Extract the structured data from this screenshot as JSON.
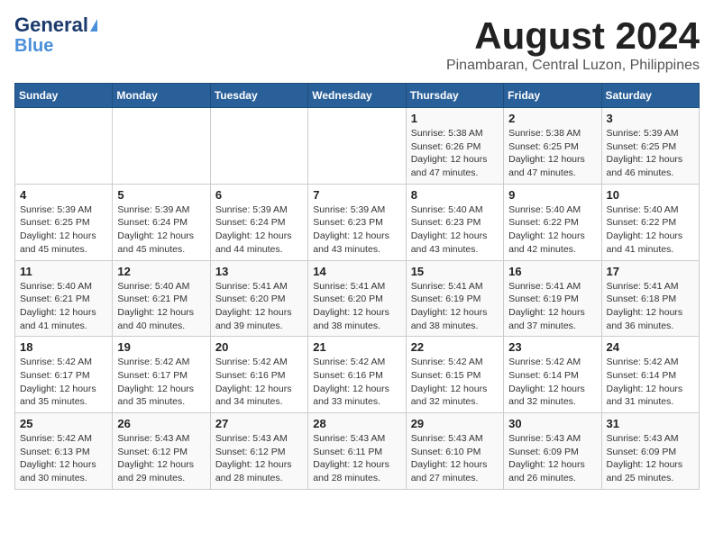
{
  "header": {
    "logo_line1": "General",
    "logo_line2": "Blue",
    "title": "August 2024",
    "subtitle": "Pinambaran, Central Luzon, Philippines"
  },
  "calendar": {
    "days_of_week": [
      "Sunday",
      "Monday",
      "Tuesday",
      "Wednesday",
      "Thursday",
      "Friday",
      "Saturday"
    ],
    "weeks": [
      [
        {
          "day": "",
          "info": ""
        },
        {
          "day": "",
          "info": ""
        },
        {
          "day": "",
          "info": ""
        },
        {
          "day": "",
          "info": ""
        },
        {
          "day": "1",
          "info": "Sunrise: 5:38 AM\nSunset: 6:26 PM\nDaylight: 12 hours\nand 47 minutes."
        },
        {
          "day": "2",
          "info": "Sunrise: 5:38 AM\nSunset: 6:25 PM\nDaylight: 12 hours\nand 47 minutes."
        },
        {
          "day": "3",
          "info": "Sunrise: 5:39 AM\nSunset: 6:25 PM\nDaylight: 12 hours\nand 46 minutes."
        }
      ],
      [
        {
          "day": "4",
          "info": "Sunrise: 5:39 AM\nSunset: 6:25 PM\nDaylight: 12 hours\nand 45 minutes."
        },
        {
          "day": "5",
          "info": "Sunrise: 5:39 AM\nSunset: 6:24 PM\nDaylight: 12 hours\nand 45 minutes."
        },
        {
          "day": "6",
          "info": "Sunrise: 5:39 AM\nSunset: 6:24 PM\nDaylight: 12 hours\nand 44 minutes."
        },
        {
          "day": "7",
          "info": "Sunrise: 5:39 AM\nSunset: 6:23 PM\nDaylight: 12 hours\nand 43 minutes."
        },
        {
          "day": "8",
          "info": "Sunrise: 5:40 AM\nSunset: 6:23 PM\nDaylight: 12 hours\nand 43 minutes."
        },
        {
          "day": "9",
          "info": "Sunrise: 5:40 AM\nSunset: 6:22 PM\nDaylight: 12 hours\nand 42 minutes."
        },
        {
          "day": "10",
          "info": "Sunrise: 5:40 AM\nSunset: 6:22 PM\nDaylight: 12 hours\nand 41 minutes."
        }
      ],
      [
        {
          "day": "11",
          "info": "Sunrise: 5:40 AM\nSunset: 6:21 PM\nDaylight: 12 hours\nand 41 minutes."
        },
        {
          "day": "12",
          "info": "Sunrise: 5:40 AM\nSunset: 6:21 PM\nDaylight: 12 hours\nand 40 minutes."
        },
        {
          "day": "13",
          "info": "Sunrise: 5:41 AM\nSunset: 6:20 PM\nDaylight: 12 hours\nand 39 minutes."
        },
        {
          "day": "14",
          "info": "Sunrise: 5:41 AM\nSunset: 6:20 PM\nDaylight: 12 hours\nand 38 minutes."
        },
        {
          "day": "15",
          "info": "Sunrise: 5:41 AM\nSunset: 6:19 PM\nDaylight: 12 hours\nand 38 minutes."
        },
        {
          "day": "16",
          "info": "Sunrise: 5:41 AM\nSunset: 6:19 PM\nDaylight: 12 hours\nand 37 minutes."
        },
        {
          "day": "17",
          "info": "Sunrise: 5:41 AM\nSunset: 6:18 PM\nDaylight: 12 hours\nand 36 minutes."
        }
      ],
      [
        {
          "day": "18",
          "info": "Sunrise: 5:42 AM\nSunset: 6:17 PM\nDaylight: 12 hours\nand 35 minutes."
        },
        {
          "day": "19",
          "info": "Sunrise: 5:42 AM\nSunset: 6:17 PM\nDaylight: 12 hours\nand 35 minutes."
        },
        {
          "day": "20",
          "info": "Sunrise: 5:42 AM\nSunset: 6:16 PM\nDaylight: 12 hours\nand 34 minutes."
        },
        {
          "day": "21",
          "info": "Sunrise: 5:42 AM\nSunset: 6:16 PM\nDaylight: 12 hours\nand 33 minutes."
        },
        {
          "day": "22",
          "info": "Sunrise: 5:42 AM\nSunset: 6:15 PM\nDaylight: 12 hours\nand 32 minutes."
        },
        {
          "day": "23",
          "info": "Sunrise: 5:42 AM\nSunset: 6:14 PM\nDaylight: 12 hours\nand 32 minutes."
        },
        {
          "day": "24",
          "info": "Sunrise: 5:42 AM\nSunset: 6:14 PM\nDaylight: 12 hours\nand 31 minutes."
        }
      ],
      [
        {
          "day": "25",
          "info": "Sunrise: 5:42 AM\nSunset: 6:13 PM\nDaylight: 12 hours\nand 30 minutes."
        },
        {
          "day": "26",
          "info": "Sunrise: 5:43 AM\nSunset: 6:12 PM\nDaylight: 12 hours\nand 29 minutes."
        },
        {
          "day": "27",
          "info": "Sunrise: 5:43 AM\nSunset: 6:12 PM\nDaylight: 12 hours\nand 28 minutes."
        },
        {
          "day": "28",
          "info": "Sunrise: 5:43 AM\nSunset: 6:11 PM\nDaylight: 12 hours\nand 28 minutes."
        },
        {
          "day": "29",
          "info": "Sunrise: 5:43 AM\nSunset: 6:10 PM\nDaylight: 12 hours\nand 27 minutes."
        },
        {
          "day": "30",
          "info": "Sunrise: 5:43 AM\nSunset: 6:09 PM\nDaylight: 12 hours\nand 26 minutes."
        },
        {
          "day": "31",
          "info": "Sunrise: 5:43 AM\nSunset: 6:09 PM\nDaylight: 12 hours\nand 25 minutes."
        }
      ]
    ]
  }
}
